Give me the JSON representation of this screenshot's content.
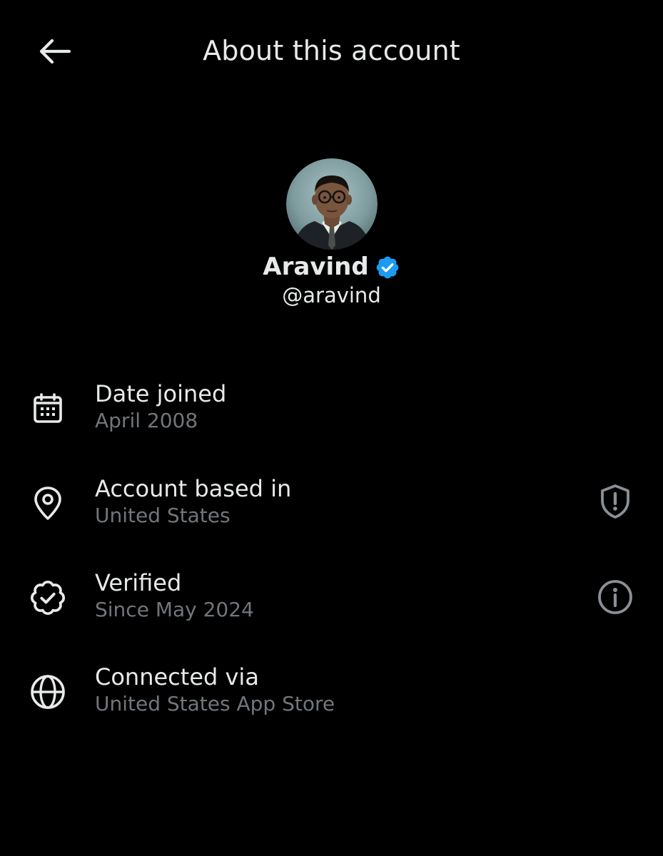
{
  "header": {
    "title": "About this account",
    "back_icon": "arrow-left-icon"
  },
  "profile": {
    "display_name": "Aravind",
    "handle": "@aravind",
    "verified_badge_color": "#1d9bf0"
  },
  "rows": [
    {
      "label": "Date joined",
      "value": "April 2008",
      "icon": "calendar-icon"
    },
    {
      "label": "Account based in",
      "value": "United States",
      "icon": "location-pin-icon",
      "action_icon": "shield-alert-icon"
    },
    {
      "label": "Verified",
      "value": "Since May 2024",
      "icon": "verified-badge-outline-icon",
      "action_icon": "info-icon"
    },
    {
      "label": "Connected via",
      "value": "United States App Store",
      "icon": "globe-icon"
    }
  ],
  "colors": {
    "background": "#000000",
    "primary_text": "#e7e9ea",
    "secondary_text": "#71767b",
    "icon": "#e7e9ea",
    "action_icon": "#8b9096",
    "accent": "#1d9bf0"
  }
}
